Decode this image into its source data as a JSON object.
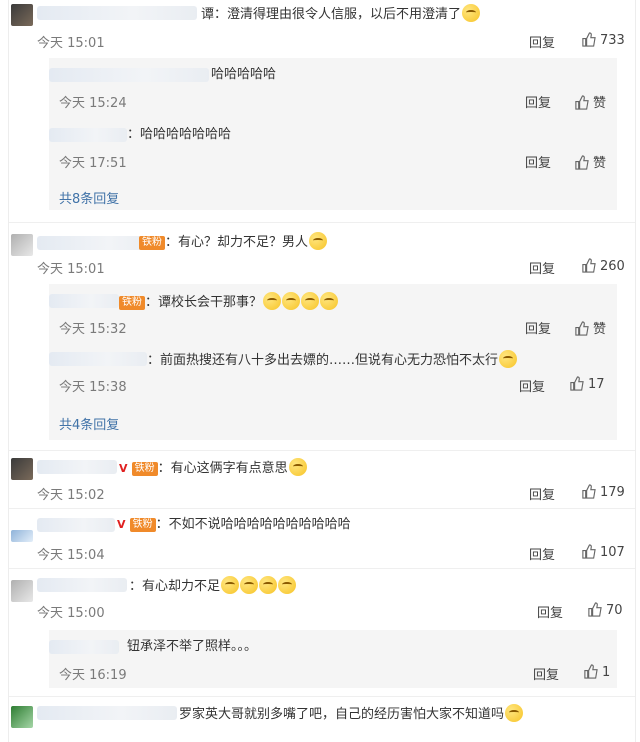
{
  "comments": [
    {
      "text": "谭：澄清得理由很令人信服，以后不用澄清了",
      "emoji_count": 1,
      "time": "今天 15:01",
      "reply_label": "回复",
      "likes": "733",
      "replies": [
        {
          "text": "哈哈哈哈哈",
          "time": "今天 15:24",
          "reply_label": "回复",
          "likes": "赞"
        },
        {
          "text": "：哈哈哈哈哈哈哈",
          "time": "今天 17:51",
          "reply_label": "回复",
          "likes": "赞"
        }
      ],
      "more_replies": "共8条回复"
    },
    {
      "text": "：有心？却力不足？男人",
      "emoji_count": 1,
      "time": "今天 15:01",
      "reply_label": "回复",
      "likes": "260",
      "replies": [
        {
          "text": "：谭校长会干那事？",
          "emoji_count": 4,
          "time": "今天 15:32",
          "reply_label": "回复",
          "likes": "赞"
        },
        {
          "text": "：前面热搜还有八十多出去嫖的……但说有心无力恐怕不太行",
          "emoji_count": 1,
          "time": "今天 15:38",
          "reply_label": "回复",
          "likes": "17"
        }
      ],
      "more_replies": "共4条回复"
    },
    {
      "text": "：有心这俩字有点意思",
      "emoji_count": 1,
      "time": "今天 15:02",
      "reply_label": "回复",
      "likes": "179"
    },
    {
      "text": "：不如不说哈哈哈哈哈哈哈哈哈哈",
      "time": "今天 15:04",
      "reply_label": "回复",
      "likes": "107"
    },
    {
      "text": "：有心却力不足",
      "emoji_count": 4,
      "time": "今天 15:00",
      "reply_label": "回复",
      "likes": "70",
      "replies": [
        {
          "text": "钮承泽不举了照样。。。",
          "time": "今天 16:19",
          "reply_label": "回复",
          "likes": "1"
        }
      ]
    },
    {
      "text": "罗家英大哥就别多嘴了吧，自己的经历害怕大家不知道吗",
      "emoji_count": 1
    }
  ],
  "badges": {
    "fan_badge": "铁粉",
    "vip": "V"
  },
  "colors": {
    "link": "#4173a8",
    "reply_bg": "#f5f5f5",
    "time": "#7a7a7a"
  },
  "icons": {
    "like": "thumbs-up-icon",
    "avatar": "user-avatar"
  }
}
